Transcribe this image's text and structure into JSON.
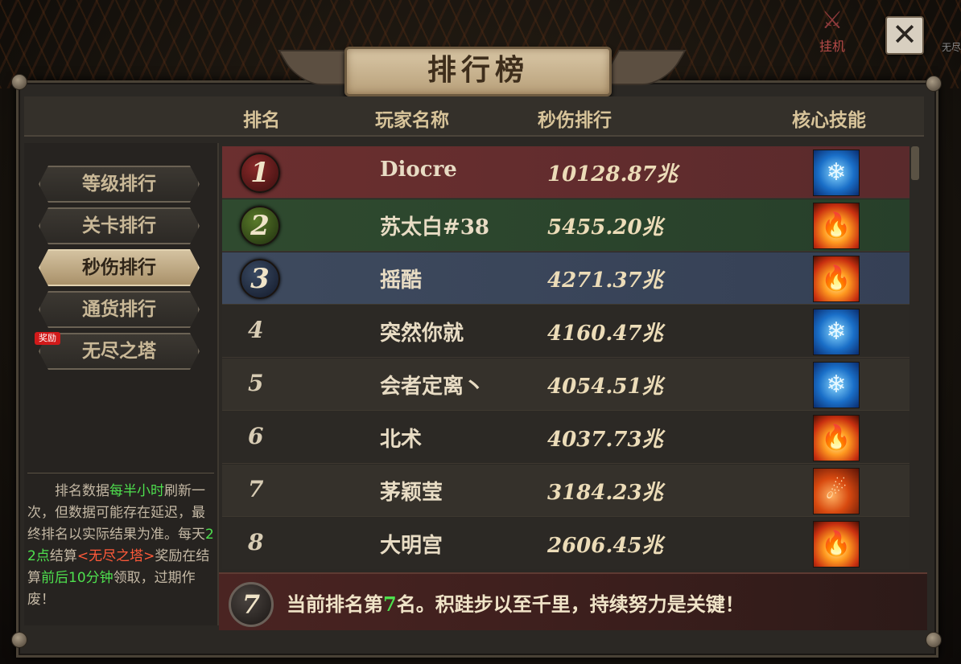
{
  "window": {
    "title": "排行榜"
  },
  "top_buttons": {
    "idle_label": "挂机",
    "side_hint": "无尽"
  },
  "header": {
    "rank": "排名",
    "player_name": "玩家名称",
    "dps_rank": "秒伤排行",
    "core_skill": "核心技能"
  },
  "tabs": [
    {
      "label": "等级排行",
      "active": false
    },
    {
      "label": "关卡排行",
      "active": false
    },
    {
      "label": "秒伤排行",
      "active": true
    },
    {
      "label": "通货排行",
      "active": false
    },
    {
      "label": "无尽之塔",
      "active": false
    }
  ],
  "reward_badge": "奖励",
  "note": {
    "p1": "排名数据",
    "g1": "每半小时",
    "p2": "刷新一次，但数据可能存在延迟，最终排名以实际结果为准。每天",
    "g2": "22点",
    "p3": "结算",
    "r1": "<无尽之塔>",
    "p4": "奖励在结算",
    "g3": "前后10分钟",
    "p5": "领取，过期作废！"
  },
  "rows": [
    {
      "rank": "1",
      "name": "Diocre",
      "dps": "10128.87兆",
      "skill": "ice-skill"
    },
    {
      "rank": "2",
      "name": "苏太白#38",
      "dps": "5455.20兆",
      "skill": "fire-skill"
    },
    {
      "rank": "3",
      "name": "摇酷",
      "dps": "4271.37兆",
      "skill": "fire-skill"
    },
    {
      "rank": "4",
      "name": "突然你就",
      "dps": "4160.47兆",
      "skill": "ice-skill"
    },
    {
      "rank": "5",
      "name": "会者定离丶",
      "dps": "4054.51兆",
      "skill": "ice-skill"
    },
    {
      "rank": "6",
      "name": "北术",
      "dps": "4037.73兆",
      "skill": "fire-skill"
    },
    {
      "rank": "7",
      "name": "茅颖莹",
      "dps": "3184.23兆",
      "skill": "meteor-skill"
    },
    {
      "rank": "8",
      "name": "大明宫",
      "dps": "2606.45兆",
      "skill": "fire-skill"
    }
  ],
  "my_rank": {
    "rank": "7",
    "prefix": "当前排名第",
    "value": "7",
    "suffix": "名。积跬步以至千里，持续努力是关键！"
  },
  "icons": {
    "close": "close-icon",
    "idle": "crossed-swords-icon",
    "ice": "snowflake-icon",
    "fire": "flame-icon"
  }
}
